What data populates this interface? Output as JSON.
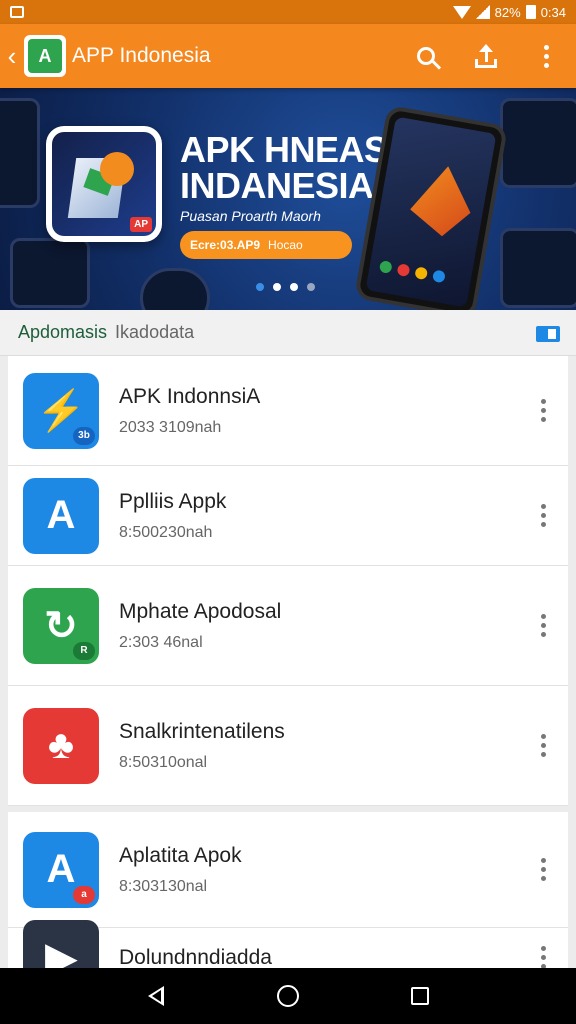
{
  "status_bar": {
    "battery_text": "82%",
    "time": "0:34"
  },
  "app_bar": {
    "title": "APP Indonesia",
    "logo_letter": "A"
  },
  "banner": {
    "title_line1": "APK HNEASIA",
    "title_line2": "INDANESIA",
    "subtitle": "Puasan Proarth Maorh",
    "cta_bold": "Ecre:03.AP9",
    "cta_text": "Hocao",
    "icon_badge": "AP",
    "pager_count": 4,
    "pager_active": 0
  },
  "section": {
    "title": "Apdomasis",
    "subtitle": "Ikadodata"
  },
  "items": [
    {
      "title": "APK IndonnsiA",
      "subtitle": "2033 3109nah",
      "icon_color": "#1e88e5",
      "icon_glyph": "⚡",
      "badge": "3b",
      "badge_color": "#1565c0"
    },
    {
      "title": "Pplliis Appk",
      "subtitle": "8:500230nah",
      "icon_color": "#1e88e5",
      "icon_glyph": "A",
      "badge": "",
      "badge_color": ""
    },
    {
      "title": "Mphate Apodosal",
      "subtitle": "2:303 46nal",
      "icon_color": "#2ea44f",
      "icon_glyph": "↻",
      "badge": "R",
      "badge_color": "#1b7a36"
    },
    {
      "title": "Snalkrintenatilens",
      "subtitle": "8:50310onal",
      "icon_color": "#e53935",
      "icon_glyph": "♣",
      "badge": "",
      "badge_color": ""
    },
    {
      "title": "Aplatita Apok",
      "subtitle": "8:303130nal",
      "icon_color": "#1e88e5",
      "icon_glyph": "A",
      "badge": "a",
      "badge_color": "#e53935"
    },
    {
      "title": "Dolundnndiadda",
      "subtitle": "",
      "icon_color": "#2a3444",
      "icon_glyph": "▶",
      "badge": "",
      "badge_color": ""
    }
  ],
  "colors": {
    "app_bar": "#f5871f",
    "status_bar": "#d9730c",
    "banner_bg": "#12306a",
    "accent": "#1e88e5"
  }
}
